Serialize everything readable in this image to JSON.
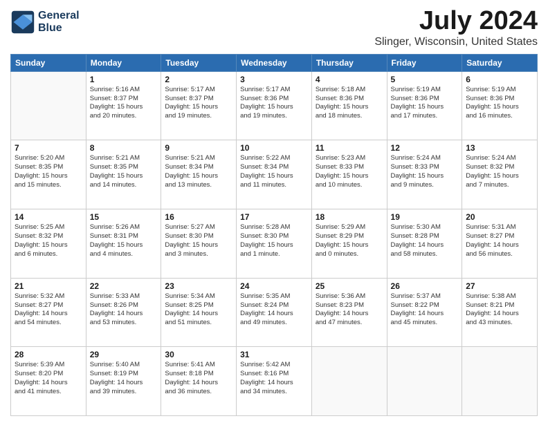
{
  "header": {
    "logo_line1": "General",
    "logo_line2": "Blue",
    "title": "July 2024",
    "subtitle": "Slinger, Wisconsin, United States"
  },
  "days_of_week": [
    "Sunday",
    "Monday",
    "Tuesday",
    "Wednesday",
    "Thursday",
    "Friday",
    "Saturday"
  ],
  "weeks": [
    [
      {
        "day": "",
        "info": ""
      },
      {
        "day": "1",
        "info": "Sunrise: 5:16 AM\nSunset: 8:37 PM\nDaylight: 15 hours\nand 20 minutes."
      },
      {
        "day": "2",
        "info": "Sunrise: 5:17 AM\nSunset: 8:37 PM\nDaylight: 15 hours\nand 19 minutes."
      },
      {
        "day": "3",
        "info": "Sunrise: 5:17 AM\nSunset: 8:36 PM\nDaylight: 15 hours\nand 19 minutes."
      },
      {
        "day": "4",
        "info": "Sunrise: 5:18 AM\nSunset: 8:36 PM\nDaylight: 15 hours\nand 18 minutes."
      },
      {
        "day": "5",
        "info": "Sunrise: 5:19 AM\nSunset: 8:36 PM\nDaylight: 15 hours\nand 17 minutes."
      },
      {
        "day": "6",
        "info": "Sunrise: 5:19 AM\nSunset: 8:36 PM\nDaylight: 15 hours\nand 16 minutes."
      }
    ],
    [
      {
        "day": "7",
        "info": "Sunrise: 5:20 AM\nSunset: 8:35 PM\nDaylight: 15 hours\nand 15 minutes."
      },
      {
        "day": "8",
        "info": "Sunrise: 5:21 AM\nSunset: 8:35 PM\nDaylight: 15 hours\nand 14 minutes."
      },
      {
        "day": "9",
        "info": "Sunrise: 5:21 AM\nSunset: 8:34 PM\nDaylight: 15 hours\nand 13 minutes."
      },
      {
        "day": "10",
        "info": "Sunrise: 5:22 AM\nSunset: 8:34 PM\nDaylight: 15 hours\nand 11 minutes."
      },
      {
        "day": "11",
        "info": "Sunrise: 5:23 AM\nSunset: 8:33 PM\nDaylight: 15 hours\nand 10 minutes."
      },
      {
        "day": "12",
        "info": "Sunrise: 5:24 AM\nSunset: 8:33 PM\nDaylight: 15 hours\nand 9 minutes."
      },
      {
        "day": "13",
        "info": "Sunrise: 5:24 AM\nSunset: 8:32 PM\nDaylight: 15 hours\nand 7 minutes."
      }
    ],
    [
      {
        "day": "14",
        "info": "Sunrise: 5:25 AM\nSunset: 8:32 PM\nDaylight: 15 hours\nand 6 minutes."
      },
      {
        "day": "15",
        "info": "Sunrise: 5:26 AM\nSunset: 8:31 PM\nDaylight: 15 hours\nand 4 minutes."
      },
      {
        "day": "16",
        "info": "Sunrise: 5:27 AM\nSunset: 8:30 PM\nDaylight: 15 hours\nand 3 minutes."
      },
      {
        "day": "17",
        "info": "Sunrise: 5:28 AM\nSunset: 8:30 PM\nDaylight: 15 hours\nand 1 minute."
      },
      {
        "day": "18",
        "info": "Sunrise: 5:29 AM\nSunset: 8:29 PM\nDaylight: 15 hours\nand 0 minutes."
      },
      {
        "day": "19",
        "info": "Sunrise: 5:30 AM\nSunset: 8:28 PM\nDaylight: 14 hours\nand 58 minutes."
      },
      {
        "day": "20",
        "info": "Sunrise: 5:31 AM\nSunset: 8:27 PM\nDaylight: 14 hours\nand 56 minutes."
      }
    ],
    [
      {
        "day": "21",
        "info": "Sunrise: 5:32 AM\nSunset: 8:27 PM\nDaylight: 14 hours\nand 54 minutes."
      },
      {
        "day": "22",
        "info": "Sunrise: 5:33 AM\nSunset: 8:26 PM\nDaylight: 14 hours\nand 53 minutes."
      },
      {
        "day": "23",
        "info": "Sunrise: 5:34 AM\nSunset: 8:25 PM\nDaylight: 14 hours\nand 51 minutes."
      },
      {
        "day": "24",
        "info": "Sunrise: 5:35 AM\nSunset: 8:24 PM\nDaylight: 14 hours\nand 49 minutes."
      },
      {
        "day": "25",
        "info": "Sunrise: 5:36 AM\nSunset: 8:23 PM\nDaylight: 14 hours\nand 47 minutes."
      },
      {
        "day": "26",
        "info": "Sunrise: 5:37 AM\nSunset: 8:22 PM\nDaylight: 14 hours\nand 45 minutes."
      },
      {
        "day": "27",
        "info": "Sunrise: 5:38 AM\nSunset: 8:21 PM\nDaylight: 14 hours\nand 43 minutes."
      }
    ],
    [
      {
        "day": "28",
        "info": "Sunrise: 5:39 AM\nSunset: 8:20 PM\nDaylight: 14 hours\nand 41 minutes."
      },
      {
        "day": "29",
        "info": "Sunrise: 5:40 AM\nSunset: 8:19 PM\nDaylight: 14 hours\nand 39 minutes."
      },
      {
        "day": "30",
        "info": "Sunrise: 5:41 AM\nSunset: 8:18 PM\nDaylight: 14 hours\nand 36 minutes."
      },
      {
        "day": "31",
        "info": "Sunrise: 5:42 AM\nSunset: 8:16 PM\nDaylight: 14 hours\nand 34 minutes."
      },
      {
        "day": "",
        "info": ""
      },
      {
        "day": "",
        "info": ""
      },
      {
        "day": "",
        "info": ""
      }
    ]
  ]
}
